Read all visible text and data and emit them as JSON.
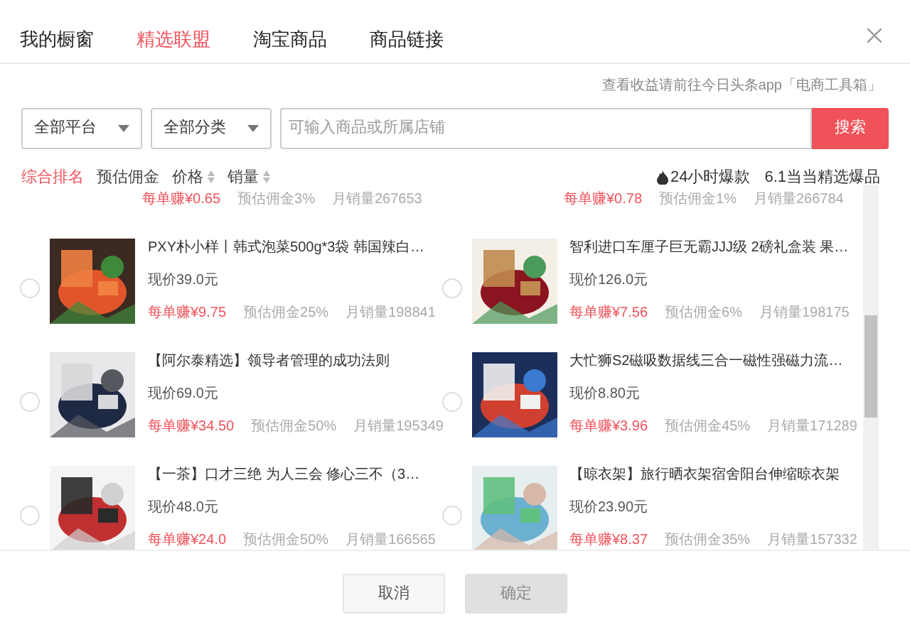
{
  "tabs": [
    {
      "label": "我的橱窗",
      "selected": false
    },
    {
      "label": "精选联盟",
      "selected": true
    },
    {
      "label": "淘宝商品",
      "selected": false
    },
    {
      "label": "商品链接",
      "selected": false
    }
  ],
  "hint": "查看收益请前往今日头条app「电商工具箱」",
  "filters": [
    {
      "label": "全部平台"
    },
    {
      "label": "全部分类"
    }
  ],
  "search": {
    "placeholder": "可输入商品或所属店铺",
    "button": "搜索"
  },
  "sort": [
    {
      "label": "综合排名",
      "selected": true,
      "sortable": false
    },
    {
      "label": "预估佣金",
      "selected": false,
      "sortable": false
    },
    {
      "label": "价格",
      "selected": false,
      "sortable": true
    },
    {
      "label": "销量",
      "selected": false,
      "sortable": true
    }
  ],
  "featured": [
    {
      "label": "24小时爆款",
      "hot": true
    },
    {
      "label": "6.1当当精选爆品",
      "hot": false
    }
  ],
  "products": [
    {
      "earn": "每单赚¥0.65",
      "commission": "预估佣金3%",
      "sales": "月销量267653"
    },
    {
      "earn": "每单赚¥0.78",
      "commission": "预估佣金1%",
      "sales": "月销量266784"
    },
    {
      "title": "PXY朴小样丨韩式泡菜500g*3袋 韩国辣白…",
      "price": "现价39.0元",
      "earn": "每单赚¥9.75",
      "commission": "预估佣金25%",
      "sales": "月销量198841",
      "selected": false
    },
    {
      "title": "智利进口车厘子巨无霸JJJ级 2磅礼盒装 果…",
      "price": "现价126.0元",
      "earn": "每单赚¥7.56",
      "commission": "预估佣金6%",
      "sales": "月销量198175",
      "selected": false
    },
    {
      "title": "【阿尔泰精选】领导者管理的成功法则",
      "price": "现价69.0元",
      "earn": "每单赚¥34.50",
      "commission": "预估佣金50%",
      "sales": "月销量195349",
      "selected": false
    },
    {
      "title": "大忙狮S2磁吸数据线三合一磁性强磁力流…",
      "price": "现价8.80元",
      "earn": "每单赚¥3.96",
      "commission": "预估佣金45%",
      "sales": "月销量171289",
      "selected": false
    },
    {
      "title": "【一茶】口才三绝 为人三会 修心三不（3…",
      "price": "现价48.0元",
      "earn": "每单赚¥24.0",
      "commission": "预估佣金50%",
      "sales": "月销量166565",
      "selected": false
    },
    {
      "title": "【晾衣架】旅行晒衣架宿舍阳台伸缩晾衣架",
      "price": "现价23.90元",
      "earn": "每单赚¥8.37",
      "commission": "预估佣金35%",
      "sales": "月销量157332",
      "selected": false
    }
  ],
  "buttons": [
    {
      "label": "取消",
      "disabled": false
    },
    {
      "label": "确定",
      "disabled": true
    }
  ]
}
